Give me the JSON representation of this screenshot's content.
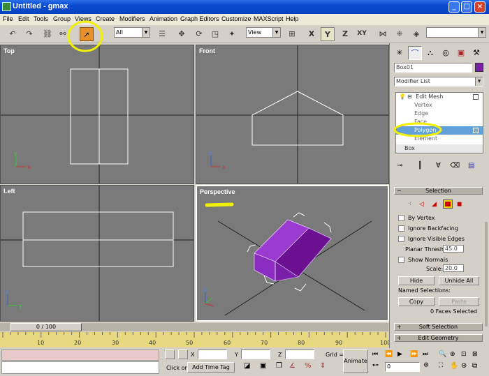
{
  "window": {
    "title": "Untitled - gmax"
  },
  "menu": [
    "File",
    "Edit",
    "Tools",
    "Group",
    "Views",
    "Create",
    "Modifiers",
    "Animation",
    "Graph Editors",
    "Customize",
    "MAXScript",
    "Help"
  ],
  "toolbar": {
    "selection_filter": "All",
    "reference_coord": "View",
    "axis_x": "X",
    "axis_y": "Y",
    "axis_z": "Z",
    "axis_xy": "XY"
  },
  "viewports": {
    "top": "Top",
    "front": "Front",
    "left": "Left",
    "perspective": "Perspective"
  },
  "time_slider": {
    "label": "0 / 100",
    "current_frame": 0,
    "total_frames": 100
  },
  "track_bar": {
    "ticks": [
      "0",
      "10",
      "20",
      "30",
      "40",
      "50",
      "60",
      "70",
      "80",
      "90",
      "100"
    ]
  },
  "status_bar": {
    "x_label": "X",
    "y_label": "Y",
    "z_label": "Z",
    "grid_label": "Grid =",
    "animate_label": "Animate",
    "click_or": "Click or",
    "add_time_tag": "Add Time Tag",
    "frame_value": "0"
  },
  "command_panel": {
    "object_name": "Box01",
    "object_color": "#7a1fa8",
    "modifier_list": "Modifier List",
    "stack": {
      "edit_mesh": "Edit Mesh",
      "vertex": "Vertex",
      "edge": "Edge",
      "face": "Face",
      "polygon": "Polygon",
      "element": "Element",
      "box": "Box"
    },
    "selection_rollout": {
      "title": "Selection",
      "by_vertex": "By Vertex",
      "ignore_backfacing": "Ignore Backfacing",
      "ignore_visible_edges": "Ignore Visible Edges",
      "planar_thresh_label": "Planar Thresh:",
      "planar_thresh_value": "45.0",
      "show_normals": "Show Normals",
      "scale_label": "Scale:",
      "scale_value": "20.0",
      "hide": "Hide",
      "unhide_all": "Unhide All",
      "named_selections": "Named Selections:",
      "copy": "Copy",
      "paste": "Paste",
      "status": "0 Faces Selected"
    },
    "soft_selection": "Soft Selection",
    "edit_geometry": "Edit Geometry"
  },
  "colors": {
    "highlight": "#f0f000",
    "object": "#7a1fa8",
    "selected_row": "#62a0d9",
    "track": "#e8d880"
  }
}
